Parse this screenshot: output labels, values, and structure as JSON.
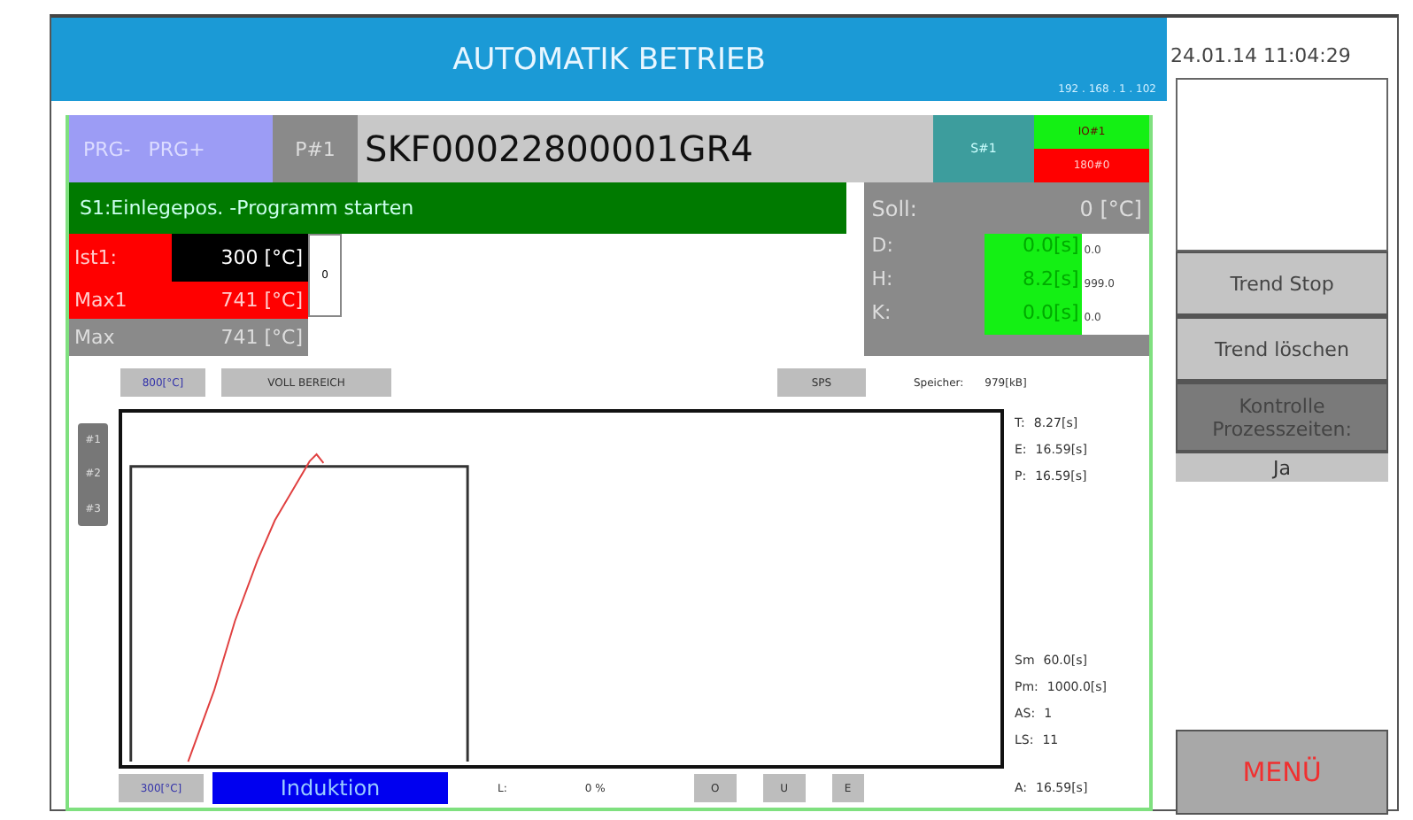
{
  "header": {
    "title": "AUTOMATIK BETRIEB",
    "ip": "192 . 168 . 1 . 102"
  },
  "program_bar": {
    "buttons": [
      "PRG-",
      "PRG+"
    ],
    "program_label": "P#1",
    "program_name": "SKF00022800001GR4",
    "station": "S#1",
    "io_ok": "IO#1",
    "io_fault": "180#0"
  },
  "status_message": "S1:Einlegepos. -Programm starten",
  "temperatures": [
    {
      "label": "Ist1:",
      "value": "300 [°C]",
      "kind": "actual"
    },
    {
      "label": "Max1",
      "value": "741 [°C]",
      "kind": "alarm"
    },
    {
      "label": "Max",
      "value": "741 [°C]",
      "kind": "plain"
    }
  ],
  "side_box": "0",
  "setpoint": {
    "label": "Soll:",
    "value": "0 [°C]"
  },
  "times": [
    {
      "label": "D:",
      "value": "0.0[s]",
      "limit": "0.0"
    },
    {
      "label": "H:",
      "value": "8.2[s]",
      "limit": "999.0"
    },
    {
      "label": "K:",
      "value": "0.0[s]",
      "limit": "0.0"
    }
  ],
  "trend_controls": {
    "scale_top": "800[°C]",
    "full_range": "VOLL BEREICH",
    "sps": "SPS",
    "memory_label": "Speicher:",
    "memory_value": "979[kB]"
  },
  "channels": [
    "#1",
    "#2",
    "#3"
  ],
  "stats_top": [
    {
      "label": "T:",
      "value": "8.27[s]"
    },
    {
      "label": "E:",
      "value": "16.59[s]"
    },
    {
      "label": "P:",
      "value": "16.59[s]"
    }
  ],
  "stats_bottom": [
    {
      "label": "Sm",
      "value": "60.0[s]"
    },
    {
      "label": "Pm:",
      "value": "1000.0[s]"
    },
    {
      "label": "AS:",
      "value": "1"
    },
    {
      "label": "LS:",
      "value": "11"
    }
  ],
  "stat_last": {
    "label": "A:",
    "value": "16.59[s]"
  },
  "bottom": {
    "scale_bottom": "300[°C]",
    "mode": "Induktion",
    "level_label": "L:",
    "level_value": "0 %",
    "buttons": [
      "O",
      "U",
      "E"
    ]
  },
  "sidebar": {
    "datetime": "24.01.14 11:04:29",
    "buttons": [
      {
        "label": "Trend Stop",
        "kind": "button"
      },
      {
        "label": "Trend löschen",
        "kind": "button"
      },
      {
        "label": "Kontrolle Prozesszeiten:",
        "kind": "toggle",
        "value": "Ja"
      }
    ],
    "menu": "MENÜ"
  }
}
